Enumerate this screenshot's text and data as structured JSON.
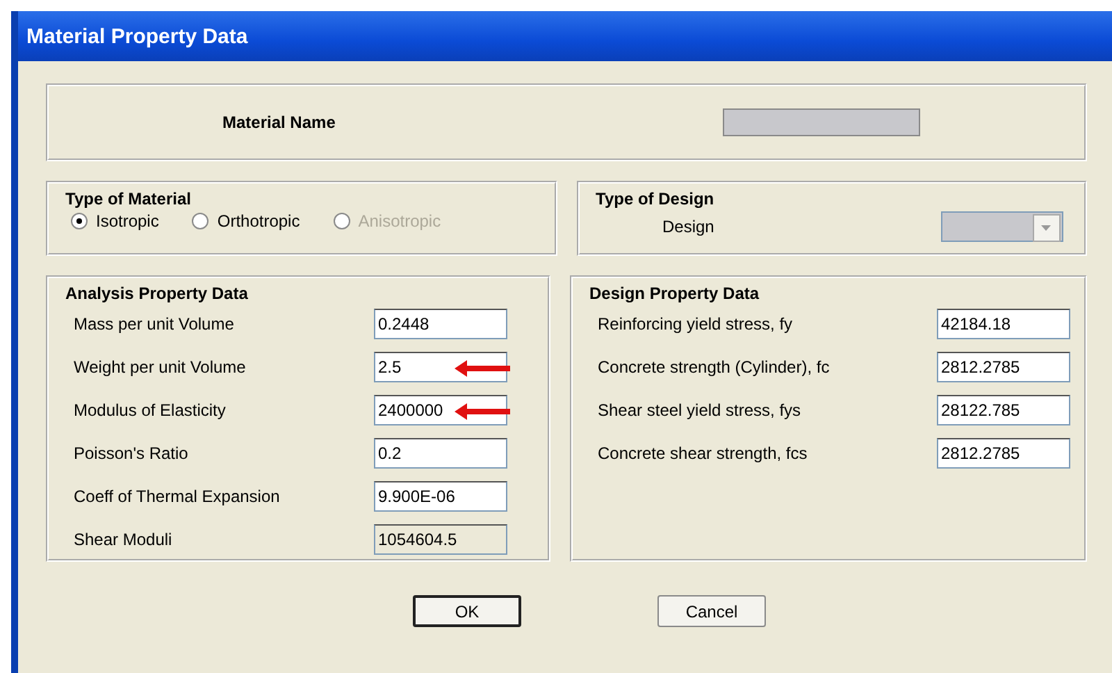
{
  "window": {
    "title": "Material Property Data"
  },
  "material_name": {
    "label": "Material Name",
    "disabled": true
  },
  "type_of_material": {
    "title": "Type of Material",
    "options": [
      {
        "label": "Isotropic",
        "selected": true,
        "disabled": false
      },
      {
        "label": "Orthotropic",
        "selected": false,
        "disabled": false
      },
      {
        "label": "Anisotropic",
        "selected": false,
        "disabled": true
      }
    ]
  },
  "type_of_design": {
    "title": "Type of Design",
    "label": "Design",
    "disabled": true
  },
  "analysis": {
    "title": "Analysis Property Data",
    "rows": [
      {
        "label": "Mass per unit Volume",
        "value": "0.2448",
        "disabled": false,
        "marked": false
      },
      {
        "label": "Weight per unit Volume",
        "value": "2.5",
        "disabled": false,
        "marked": true
      },
      {
        "label": "Modulus of Elasticity",
        "value": "2400000",
        "disabled": false,
        "marked": true
      },
      {
        "label": "Poisson's Ratio",
        "value": "0.2",
        "disabled": false,
        "marked": false
      },
      {
        "label": "Coeff of Thermal Expansion",
        "value": "9.900E-06",
        "disabled": false,
        "marked": false
      },
      {
        "label": "Shear Moduli",
        "value": "1054604.5",
        "disabled": true,
        "marked": false
      }
    ]
  },
  "design": {
    "title": "Design Property Data",
    "rows": [
      {
        "label": "Reinforcing yield stress, fy",
        "value": "42184.18",
        "disabled": false,
        "marked": false
      },
      {
        "label": "Concrete strength (Cylinder), fc",
        "value": "2812.2785",
        "disabled": false,
        "marked": false
      },
      {
        "label": "Shear steel yield stress, fys",
        "value": "28122.785",
        "disabled": false,
        "marked": false
      },
      {
        "label": "Concrete shear strength, fcs",
        "value": "2812.2785",
        "disabled": false,
        "marked": false
      }
    ]
  },
  "buttons": [
    {
      "label": "OK",
      "default": true
    },
    {
      "label": "Cancel",
      "default": false
    }
  ]
}
